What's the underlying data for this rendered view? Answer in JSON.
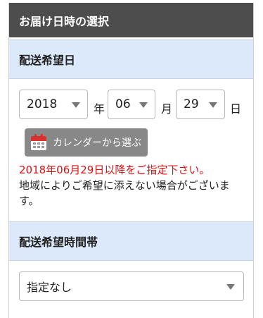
{
  "panel": {
    "title": "お届け日時の選択"
  },
  "date_section": {
    "title": "配送希望日",
    "year": {
      "value": "2018",
      "unit": "年"
    },
    "month": {
      "value": "06",
      "unit": "月"
    },
    "day": {
      "value": "29",
      "unit": "日"
    },
    "calendar_button": {
      "label": "カレンダーから選ぶ",
      "icon": "calendar-icon"
    },
    "notice_red": "2018年06月29日以降をご指定下さい。",
    "notice_text": "地域によりご希望に添えない場合がございます。"
  },
  "time_section": {
    "title": "配送希望時間帯",
    "select": {
      "value": "指定なし"
    }
  },
  "colors": {
    "header_bg": "#4d4d4d",
    "section_bg": "#dce9fb",
    "notice_red": "#e01010",
    "button_bg": "#888888",
    "calendar_icon_red": "#d9312b"
  }
}
